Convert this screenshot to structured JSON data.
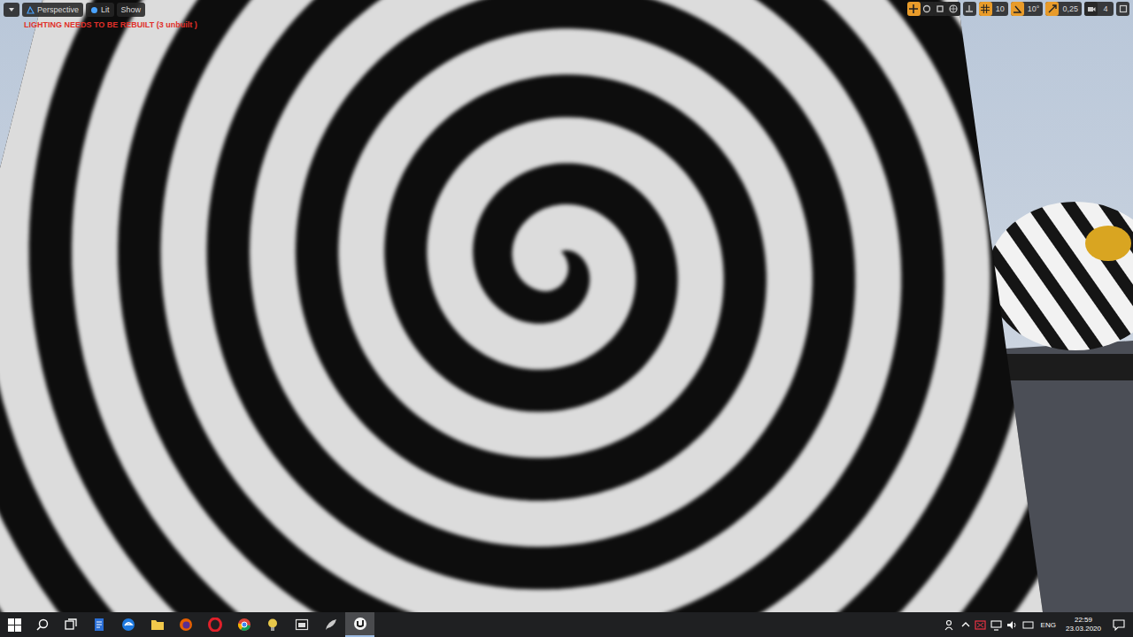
{
  "viewport": {
    "toolbar_left": [
      {
        "label": "Perspective"
      },
      {
        "label": "Lit"
      },
      {
        "label": "Show"
      }
    ],
    "warning": "LIGHTING NEEDS TO BE REBUILT (3 unbuilt )",
    "snap_controls": [
      {
        "label": "10",
        "on": true
      },
      {
        "label": "10°",
        "on": true
      },
      {
        "label": "0,25",
        "on": true
      }
    ],
    "camera_speed": "4"
  },
  "taskbar": {
    "apps": [
      {
        "active": false
      },
      {
        "active": false
      },
      {
        "active": false
      },
      {
        "active": false
      },
      {
        "active": false
      },
      {
        "active": false
      },
      {
        "active": false
      },
      {
        "active": false
      },
      {
        "active": false
      },
      {
        "active": true
      }
    ],
    "language": "ENG",
    "time": "22:59",
    "date": "23.03.2020"
  }
}
